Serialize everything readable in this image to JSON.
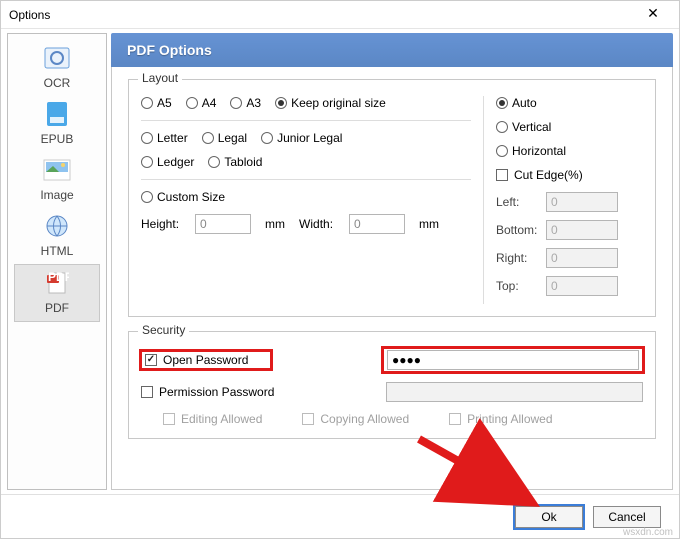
{
  "window": {
    "title": "Options"
  },
  "sidebar": {
    "items": [
      {
        "label": "OCR"
      },
      {
        "label": "EPUB"
      },
      {
        "label": "Image"
      },
      {
        "label": "HTML"
      },
      {
        "label": "PDF"
      }
    ],
    "selected_index": 4
  },
  "panel": {
    "title": "PDF Options",
    "layout": {
      "legend": "Layout",
      "paper_sizes": {
        "a5": "A5",
        "a4": "A4",
        "a3": "A3",
        "keep": "Keep original size",
        "letter": "Letter",
        "legal": "Legal",
        "junior": "Junior Legal",
        "ledger": "Ledger",
        "tabloid": "Tabloid",
        "selected": "keep"
      },
      "custom": {
        "label": "Custom Size",
        "height_label": "Height:",
        "height_value": "0",
        "width_label": "Width:",
        "width_value": "0",
        "unit": "mm"
      },
      "orientation": {
        "auto": "Auto",
        "vertical": "Vertical",
        "horizontal": "Horizontal",
        "selected": "auto"
      },
      "cut_edge": {
        "label": "Cut Edge(%)",
        "checked": false,
        "left_label": "Left:",
        "left_value": "0",
        "bottom_label": "Bottom:",
        "bottom_value": "0",
        "right_label": "Right:",
        "right_value": "0",
        "top_label": "Top:",
        "top_value": "0"
      }
    },
    "security": {
      "legend": "Security",
      "open_password": {
        "label": "Open Password",
        "checked": true,
        "value": "●●●●"
      },
      "permission_password": {
        "label": "Permission Password",
        "checked": false
      },
      "editing": "Editing Allowed",
      "copying": "Copying Allowed",
      "printing": "Printing Allowed"
    }
  },
  "footer": {
    "ok": "Ok",
    "cancel": "Cancel"
  },
  "watermark": "wsxdn.com"
}
